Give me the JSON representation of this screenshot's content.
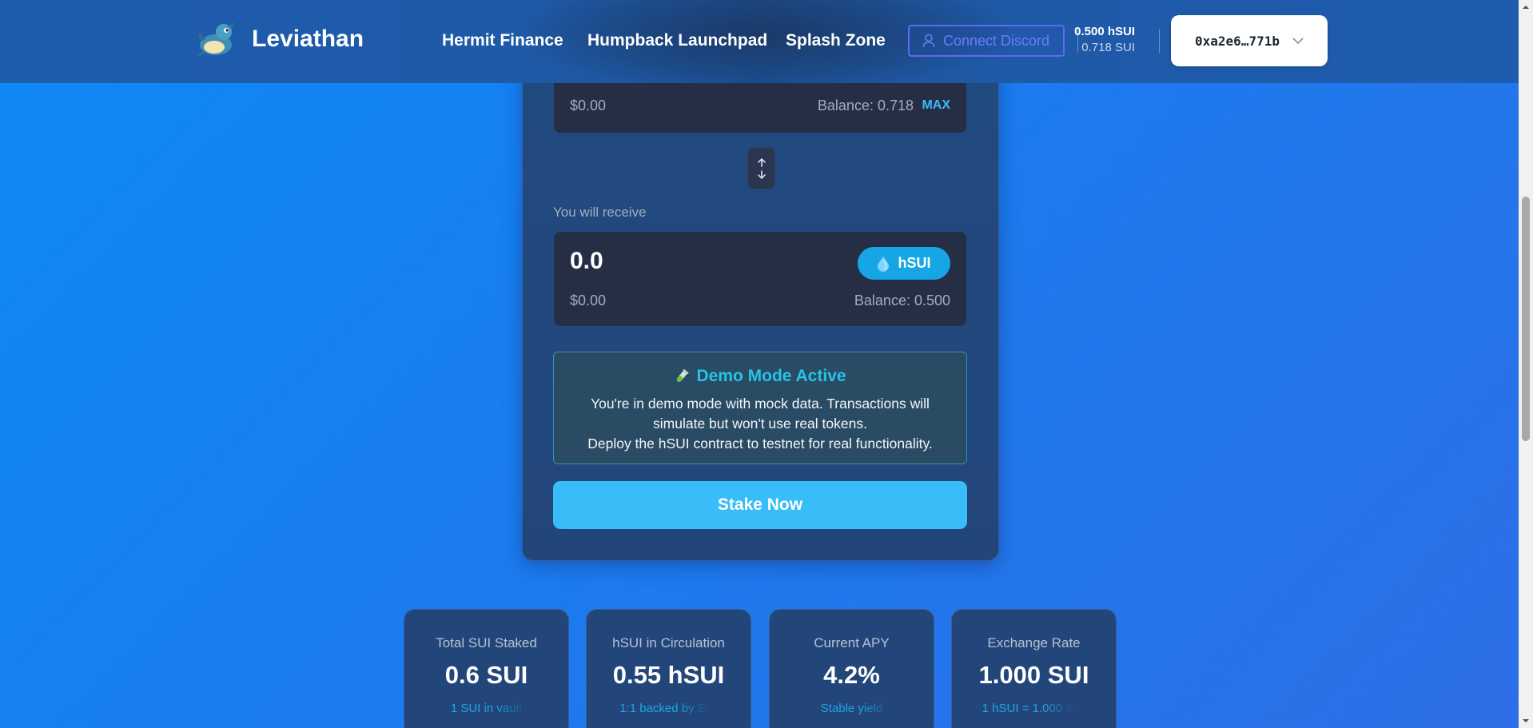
{
  "header": {
    "brand": "Leviathan",
    "nav": [
      "Hermit Finance",
      "Humpback Launchpad",
      "Splash Zone"
    ],
    "connect_discord": "Connect Discord",
    "balance_hsui": "0.500 hSUI",
    "balance_sui": "0.718 SUI",
    "wallet_address": "0xa2e6…771b",
    "icons": {
      "logo": "sea-dragon-logo",
      "user": "user-icon",
      "chevron": "chevron-down-icon"
    }
  },
  "swap": {
    "from": {
      "usd_value": "$0.00",
      "balance": "Balance: 0.718",
      "max_label": "MAX"
    },
    "switch_icon": "swap-arrows-icon",
    "receive_label": "You will receive",
    "to": {
      "amount": "0.0",
      "token": "hSUI",
      "token_icon": "water-drop-icon",
      "usd_value": "$0.00",
      "balance": "Balance: 0.500"
    },
    "demo": {
      "icon": "test-tube-icon",
      "title": "Demo Mode Active",
      "line1": "You're in demo mode with mock data. Transactions will",
      "line2": "simulate but won't use real tokens.",
      "line3": "Deploy the hSUI contract to testnet for real functionality."
    },
    "stake_button": "Stake Now"
  },
  "stats": [
    {
      "label": "Total SUI Staked",
      "value": "0.6 SUI",
      "sub": "1 SUI in vault"
    },
    {
      "label": "hSUI in Circulation",
      "value": "0.55 hSUI",
      "sub": "1:1 backed by SUI"
    },
    {
      "label": "Current APY",
      "value": "4.2%",
      "sub": "Stable yield"
    },
    {
      "label": "Exchange Rate",
      "value": "1.000 SUI",
      "sub": "1 hSUI = 1.000 SUI"
    }
  ],
  "colors": {
    "accent": "#38bdf8",
    "token_pill": "#16a6e6",
    "demo_title": "#25c3e8",
    "discord": "#6a7cf8",
    "panel": "#252e45",
    "card": "#23467a"
  }
}
